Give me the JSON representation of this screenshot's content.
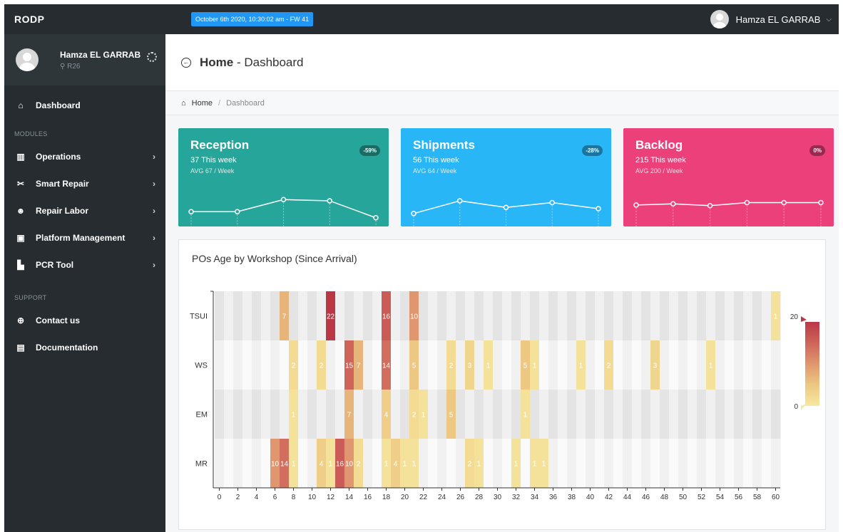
{
  "app": {
    "brand": "RODP",
    "datetime": "October 6th 2020, 10:30:02 am - FW 41",
    "user": "Hamza EL GARRAB"
  },
  "sidebar": {
    "profile": {
      "name": "Hamza EL GARRAB",
      "location": "R26"
    },
    "dashboard": "Dashboard",
    "modules_label": "MODULES",
    "modules": [
      {
        "label": "Operations",
        "icon": "chart-area-icon"
      },
      {
        "label": "Smart Repair",
        "icon": "tools-icon"
      },
      {
        "label": "Repair Labor",
        "icon": "users-icon"
      },
      {
        "label": "Platform Management",
        "icon": "server-icon"
      },
      {
        "label": "PCR Tool",
        "icon": "bar-chart-icon"
      }
    ],
    "support_label": "SUPPORT",
    "support": [
      {
        "label": "Contact us",
        "icon": "lifebuoy-icon"
      },
      {
        "label": "Documentation",
        "icon": "file-icon"
      }
    ]
  },
  "header": {
    "title_bold": "Home",
    "title_rest": " - Dashboard"
  },
  "breadcrumb": {
    "home": "Home",
    "separator": "/",
    "current": "Dashboard"
  },
  "cards": [
    {
      "title": "Reception",
      "stat": "37 This week",
      "avg": "AVG 67 / Week",
      "badge": "-59%",
      "color": "#26a69a",
      "spark": [
        55,
        55,
        75,
        73,
        45
      ]
    },
    {
      "title": "Shipments",
      "stat": "56 This week",
      "avg": "AVG 64 / Week",
      "badge": "-28%",
      "color": "#29b6f6",
      "spark": [
        52,
        73,
        62,
        70,
        60
      ]
    },
    {
      "title": "Backlog",
      "stat": "215 This week",
      "avg": "AVG 200 / Week",
      "badge": "0%",
      "color": "#ec407a",
      "spark": [
        66,
        68,
        65,
        70,
        70,
        70
      ]
    }
  ],
  "chart_title": "POs Age by Workshop (Since Arrival)",
  "chart_data": {
    "type": "heatmap",
    "title": "POs Age by Workshop (Since Arrival)",
    "rows": [
      "TSUI",
      "WS",
      "EM",
      "MR"
    ],
    "x_ticks": [
      "0",
      "2",
      "4",
      "6",
      "8",
      "10",
      "12",
      "14",
      "16",
      "18",
      "20",
      "22",
      "24",
      "26",
      "28",
      "30",
      "32",
      "34",
      "36",
      "38",
      "40",
      "42",
      "44",
      "46",
      "48",
      "50",
      "52",
      "54",
      "56",
      "58",
      "60"
    ],
    "xlim": [
      0,
      60
    ],
    "color_range": [
      0,
      20
    ],
    "legend_max_label": "20",
    "legend_min_label": "0",
    "cells": [
      {
        "row": "TSUI",
        "x": 7,
        "v": 7
      },
      {
        "row": "TSUI",
        "x": 12,
        "v": 22
      },
      {
        "row": "TSUI",
        "x": 18,
        "v": 16
      },
      {
        "row": "TSUI",
        "x": 21,
        "v": 10
      },
      {
        "row": "TSUI",
        "x": 60,
        "v": 1
      },
      {
        "row": "WS",
        "x": 8,
        "v": 2
      },
      {
        "row": "WS",
        "x": 11,
        "v": 2
      },
      {
        "row": "WS",
        "x": 14,
        "v": 15
      },
      {
        "row": "WS",
        "x": 15,
        "v": 7
      },
      {
        "row": "WS",
        "x": 18,
        "v": 14
      },
      {
        "row": "WS",
        "x": 21,
        "v": 5
      },
      {
        "row": "WS",
        "x": 25,
        "v": 2
      },
      {
        "row": "WS",
        "x": 27,
        "v": 3
      },
      {
        "row": "WS",
        "x": 29,
        "v": 1
      },
      {
        "row": "WS",
        "x": 33,
        "v": 5
      },
      {
        "row": "WS",
        "x": 34,
        "v": 1
      },
      {
        "row": "WS",
        "x": 39,
        "v": 1
      },
      {
        "row": "WS",
        "x": 42,
        "v": 2
      },
      {
        "row": "WS",
        "x": 47,
        "v": 3
      },
      {
        "row": "WS",
        "x": 53,
        "v": 1
      },
      {
        "row": "EM",
        "x": 8,
        "v": 1
      },
      {
        "row": "EM",
        "x": 14,
        "v": 7
      },
      {
        "row": "EM",
        "x": 18,
        "v": 4
      },
      {
        "row": "EM",
        "x": 21,
        "v": 2
      },
      {
        "row": "EM",
        "x": 22,
        "v": 1
      },
      {
        "row": "EM",
        "x": 25,
        "v": 5
      },
      {
        "row": "EM",
        "x": 33,
        "v": 1
      },
      {
        "row": "MR",
        "x": 6,
        "v": 10
      },
      {
        "row": "MR",
        "x": 7,
        "v": 14
      },
      {
        "row": "MR",
        "x": 8,
        "v": 1
      },
      {
        "row": "MR",
        "x": 11,
        "v": 4
      },
      {
        "row": "MR",
        "x": 12,
        "v": 1
      },
      {
        "row": "MR",
        "x": 13,
        "v": 16
      },
      {
        "row": "MR",
        "x": 14,
        "v": 10
      },
      {
        "row": "MR",
        "x": 15,
        "v": 2
      },
      {
        "row": "MR",
        "x": 18,
        "v": 1
      },
      {
        "row": "MR",
        "x": 19,
        "v": 4
      },
      {
        "row": "MR",
        "x": 20,
        "v": 1
      },
      {
        "row": "MR",
        "x": 21,
        "v": 1
      },
      {
        "row": "MR",
        "x": 27,
        "v": 2
      },
      {
        "row": "MR",
        "x": 28,
        "v": 1
      },
      {
        "row": "MR",
        "x": 32,
        "v": 1
      },
      {
        "row": "MR",
        "x": 34,
        "v": 1
      },
      {
        "row": "MR",
        "x": 35,
        "v": 1
      }
    ]
  }
}
